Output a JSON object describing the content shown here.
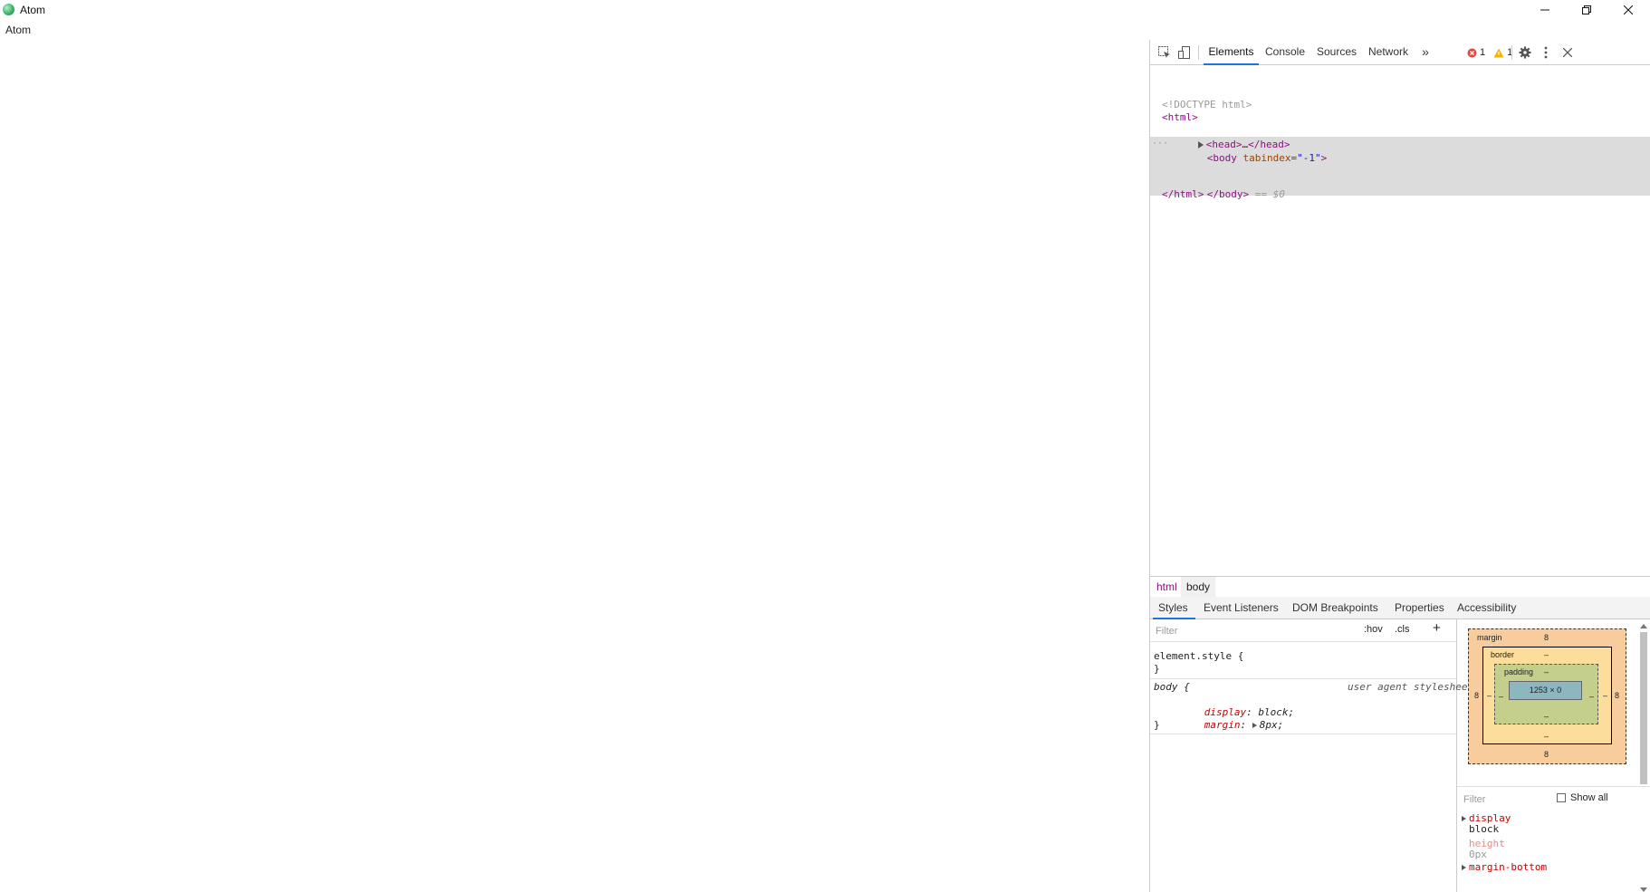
{
  "window": {
    "title": "Atom"
  },
  "page": {
    "body_text": "Atom"
  },
  "devtools": {
    "tabs": [
      "Elements",
      "Console",
      "Sources",
      "Network"
    ],
    "more_tabs": "»",
    "errors": "1",
    "warnings": "1",
    "elements": {
      "doctype": "<!DOCTYPE html>",
      "html_open": "<html>",
      "head_open": "<head>",
      "head_ellipsis": "…",
      "head_close": "</head>",
      "body_open": "<body",
      "body_attr_name": "tabindex",
      "body_attr_eq": "=",
      "body_attr_value": "\"-1\"",
      "body_open_end": ">",
      "body_close": "</body>",
      "selected_marker": "== $0",
      "row_dots": "···",
      "html_close": "</html>"
    },
    "breadcrumbs": [
      "html",
      "body"
    ],
    "sub_tabs": [
      "Styles",
      "Event Listeners",
      "DOM Breakpoints",
      "Properties",
      "Accessibility"
    ],
    "styles": {
      "filter_placeholder": "Filter",
      "hov": ":hov",
      "cls": ".cls",
      "add": "+",
      "element_style_open": "element.style {",
      "close_brace": "}",
      "body_selector": "body {",
      "source": "user agent stylesheet",
      "props": [
        {
          "name": "display",
          "value": "block;"
        },
        {
          "name": "margin",
          "value": "8px;"
        }
      ]
    },
    "box_model": {
      "margin_label": "margin",
      "margin_top": "8",
      "margin_right": "8",
      "margin_bottom": "8",
      "margin_left": "8",
      "border_label": "border",
      "border_value": "–",
      "padding_label": "padding",
      "padding_value": "–",
      "content": "1253 × 0"
    },
    "computed": {
      "filter_placeholder": "Filter",
      "show_all": "Show all",
      "props": [
        {
          "name": "display",
          "value": "block"
        },
        {
          "name": "height",
          "value": "0px"
        },
        {
          "name": "margin-bottom",
          "value": ""
        }
      ]
    },
    "colors": {
      "accent": "#1a73e8",
      "error": "#e8453c",
      "warning": "#f5b400"
    }
  }
}
